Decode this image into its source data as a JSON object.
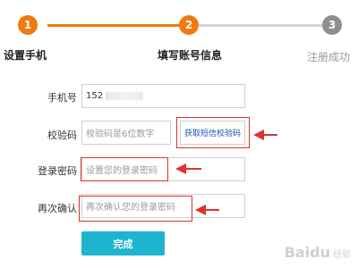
{
  "steps": [
    {
      "number": "1",
      "label": "设置手机",
      "state": "done"
    },
    {
      "number": "2",
      "label": "填写账号信息",
      "state": "current"
    },
    {
      "number": "3",
      "label": "注册成功",
      "state": "pending"
    }
  ],
  "colors": {
    "accent": "#f07a10",
    "inactive": "#8f8f8f",
    "line_inactive": "#d5d5d5",
    "annotation": "#e0312f",
    "submit": "#1db4cf",
    "link": "#1a56b0"
  },
  "form": {
    "phone": {
      "label": "手机号",
      "value": "152"
    },
    "code": {
      "label": "校验码",
      "placeholder": "校验码是6位数字",
      "sms_button": "获取短信校验码"
    },
    "password": {
      "label": "登录密码",
      "placeholder": "设置您的登录密码"
    },
    "confirm": {
      "label": "再次确认",
      "placeholder": "再次确认您的登录密码"
    },
    "submit": "完成"
  },
  "watermark": {
    "text": "Baidu",
    "subtext": "经验"
  }
}
